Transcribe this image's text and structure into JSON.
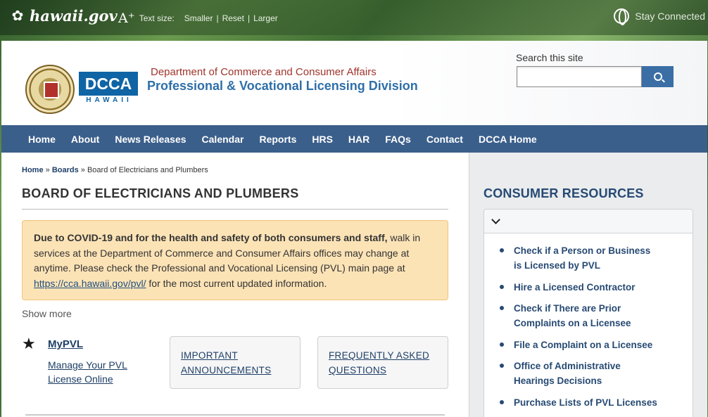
{
  "topbar": {
    "logo_text": "hawaii.gov",
    "textsize_label": "Text size:",
    "textsize_smaller": "Smaller",
    "textsize_reset": "Reset",
    "textsize_larger": "Larger",
    "stay_connected": "Stay Connected"
  },
  "header": {
    "dcca_logo": "DCCA",
    "dcca_sub": "HAWAII",
    "department": "Department of Commerce and Consumer Affairs",
    "division": "Professional & Vocational Licensing Division",
    "search_label": "Search this site",
    "search_placeholder": ""
  },
  "nav": {
    "items": [
      "Home",
      "About",
      "News Releases",
      "Calendar",
      "Reports",
      "HRS",
      "HAR",
      "FAQs",
      "Contact",
      "DCCA Home"
    ]
  },
  "breadcrumb": {
    "home": "Home",
    "sep1": "»",
    "boards": "Boards",
    "sep2": "»",
    "current": "Board of Electricians and Plumbers"
  },
  "main": {
    "title": "BOARD OF ELECTRICIANS AND PLUMBERS",
    "alert_bold": "Due to COVID-19 and for the health and safety of both consumers and staff,",
    "alert_text": " walk in services at the Department of Commerce and Consumer Affairs offices may change at anytime.  Please check the Professional and Vocational Licensing (PVL) main page at ",
    "alert_link": "https://cca.hawaii.gov/pvl/",
    "alert_tail": " for the most current updated information.",
    "show_more": "Show more",
    "mypvl_title": "MyPVL",
    "mypvl_link": "Manage Your PVL License Online",
    "card_announcements": "IMPORTANT ANNOUNCEMENTS",
    "card_faq": "FREQUENTLY ASKED QUESTIONS"
  },
  "sidebar": {
    "title": "CONSUMER RESOURCES",
    "items": [
      "Check if a Person or Business is Licensed by PVL",
      "Hire a Licensed Contractor",
      "Check if There are Prior Complaints on a Licensee",
      "File a Complaint on a Licensee",
      "Office of Administrative Hearings Decisions",
      "Purchase Lists of PVL Licenses"
    ]
  }
}
